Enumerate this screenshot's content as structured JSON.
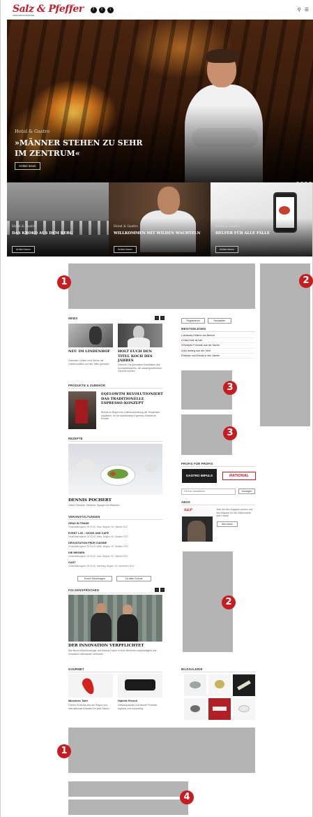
{
  "site": {
    "logo": "Salz & Pfeffer",
    "logo_sub": "DAS MAGAZIN FÜR GASTRONOMIE",
    "social": [
      "f",
      "t",
      "i"
    ],
    "search_icon": "search-icon",
    "menu_icon": "menu-icon"
  },
  "hero": {
    "kicker": "Hotel & Gastro",
    "title": "»MÄNNER STEHEN ZU SEHR IM ZENTRUM«",
    "button": "Artikel lesen",
    "slides": 4,
    "active_slide": 1
  },
  "teasers": [
    {
      "kicker": "Hotel & Gastro",
      "title": "DAS KROKO AUS DEM BERG",
      "button": "Artikel lesen"
    },
    {
      "kicker": "Hotel & Gastro",
      "title": "WILLKOMMEN MIT WILDEN WACHTELN",
      "button": "Artikel lesen"
    },
    {
      "kicker": "Hotel & Gastro",
      "title": "HELFER FÜR ALLE FÄLLE",
      "button": "Artikel lesen"
    }
  ],
  "ad_labels": {
    "a1": "1",
    "a2": "2",
    "a3": "3",
    "a4": "4"
  },
  "news": {
    "header": "NEWS",
    "items": [
      {
        "title": "NEU IM LINDENHOF",
        "text": "Zwischen Lichtern und Sterne mit Leidenschaften auf den Teller gebracht"
      },
      {
        "title": "HOLT EUCH DEN TITEL KOCH DES JAHRES",
        "text": "Gesucht: Die genialsten Kandidaten des Kochwettbewerbs, die aussergewöhnliche Gerichte kochen"
      }
    ]
  },
  "produkt": {
    "header": "PRODUKTE & ZUBEHÖR",
    "title": "EQFLOWTM REVOLUTIONIERT DAS TRADITIONELLE ESPRESSO-KONZEPT",
    "text": "Bereits zu Beginn der Kaffeezubereitung die Temperatur regulieren, für ein traditionelles Espresso-Erlebnis im Einsatz"
  },
  "rezept": {
    "header": "REZEPTE",
    "title": "DENNIS POCHERT",
    "text": "Ostern Rezepte: Steinbutt, Spargel und Bärlauch"
  },
  "events": {
    "header": "VERANSTALTUNGEN",
    "items": [
      {
        "name": "GRAZ IN TRADE",
        "date": "Veranstaltungsort: 00.00.00, Graz, Beginn: 00. Oktober 2017"
      },
      {
        "name": "EVENT 1.00 – KIOSK UND CAFÉ",
        "date": "Veranstaltungsort: 00.00.00, Wien, Beginn: 00. Oktober 2017"
      },
      {
        "name": "DEGUSTATION FRÜH CUISINE",
        "date": "Veranstaltungsort: 00.00.00, Wien, Beginn: 00. Oktober 2017"
      },
      {
        "name": "DIE MESSEN",
        "date": "Veranstaltungsort: 00.00.00, Graz, Beginn: 00. Oktober 2017"
      },
      {
        "name": "GAST",
        "date": "Veranstaltungsort: 00.00.00, Salzburg, Beginn: 00. November 2017"
      }
    ],
    "btn1": "Event Vorschlagen",
    "btn2": "Zu allen Events"
  },
  "feature": {
    "header": "FOLGENSPROCHEN",
    "title": "DER INNOVATION VERPFLICHTET",
    "text": "Wie Bernd Weichtenberger und Markus Holzer in ihren Betrieben Nachhaltigkeit und Innovation miteinander verbinden"
  },
  "gourmet": {
    "header": "GOURMET",
    "items": [
      {
        "title": "Münchner Tafel",
        "text": "Frische Produkte aus der Region und internationale Klassiker für jede Saison"
      },
      {
        "title": "Hubelte Fleisch",
        "text": "Gewürzauswahl und feinste Produkte, regional und hochwertig"
      }
    ]
  },
  "sidebar": {
    "btn_register": "Registrieren",
    "btn_newsletter": "Newsletter",
    "meistgelesen_header": "MEISTGELESEN",
    "meistgelesen": [
      {
        "num": "1",
        "label": "Andreas Döllerer am Bericht"
      },
      {
        "num": "2",
        "label": "Das Ende ist nah"
      },
      {
        "num": "3",
        "label": "Rezepte Freunde aus der Küche"
      },
      {
        "num": "4",
        "label": "Am Anfang war der Senf"
      },
      {
        "num": "5",
        "label": "Messe und Events in den Jahren"
      }
    ],
    "partner_header": "PROFIS FÜR PROFIS",
    "partner1": "GASTRO IMPULS",
    "partner2": "RATIONAL",
    "select_placeholder": "Partner auswählen",
    "select_btn": "Anzeigen",
    "abo_header": "ABOS",
    "abo_text": "Jetzt die Abo-Ausgabe sichern und das Magazin für die Gastronomie nach Hause",
    "abo_btn": "Abo lesen",
    "gallery_header": "BILDGALERIE"
  }
}
